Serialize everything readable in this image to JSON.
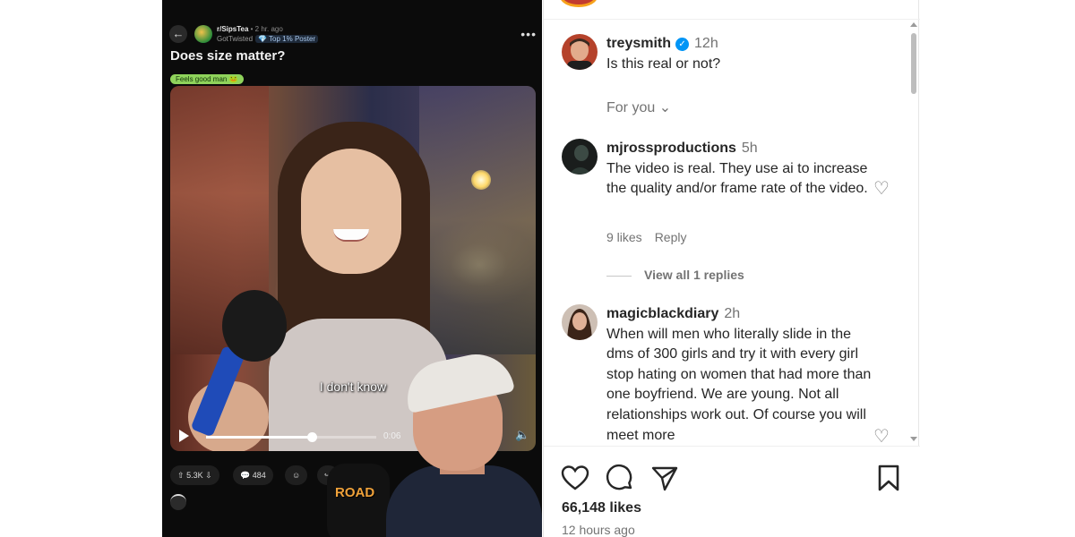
{
  "video_post": {
    "back_icon": "arrow-left-icon",
    "subreddit": "r/SipsTea",
    "time": " • 2 hr. ago",
    "author": "GotTwisted",
    "badge": "💎 Top 1% Poster",
    "menu": "•••",
    "title": "Does size matter?",
    "flair": "Feels good man 🐸",
    "caption": "I don't know",
    "time_code": "0:06",
    "progress": 0.62,
    "upvotes": "5.3K",
    "comments": "484",
    "share_label": "Share",
    "overlay_text": "ROAD"
  },
  "instagram": {
    "op": {
      "username": "treysmith",
      "time": "12h",
      "text": "Is this real or not?"
    },
    "for_you": "For you",
    "comments": [
      {
        "username": "mjrossproductions",
        "time": "5h",
        "text": "The video is real. They use ai to increase the quality and/or frame rate of the video.",
        "likes": "9 likes",
        "reply": "Reply",
        "view_replies": "View all 1 replies"
      },
      {
        "username": "magicblackdiary",
        "time": "2h",
        "text": "When will men who literally slide in the dms of 300 girls and try it with every girl stop hating on women that had more than one boyfriend. We are young. Not all relationships work out. Of course you will meet more"
      }
    ],
    "likes_count": "66,148 likes",
    "posted": "12 hours ago",
    "colors": {
      "verified": "#0095f6",
      "text": "#262626",
      "secondary": "#737373"
    }
  }
}
